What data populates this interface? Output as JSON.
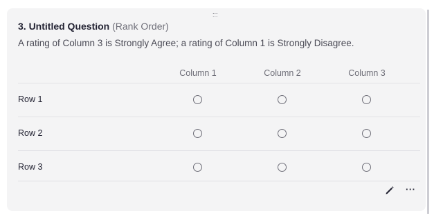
{
  "question": {
    "number_title": "3. Untitled Question",
    "type_label": "(Rank Order)",
    "description": "A rating of Column 3 is Strongly Agree; a rating of Column 1 is Strongly Disagree.",
    "drag_handle_glyph": ":::"
  },
  "columns": [
    "Column 1",
    "Column 2",
    "Column 3"
  ],
  "rows": [
    "Row 1",
    "Row 2",
    "Row 3"
  ],
  "actions": {
    "edit_icon": "pencil-icon",
    "more_icon": "more-horizontal-icon",
    "more_glyph": "···"
  },
  "colors": {
    "card_bg": "#f4f4f5",
    "text_primary": "#232333",
    "text_secondary": "#6e6e78"
  }
}
